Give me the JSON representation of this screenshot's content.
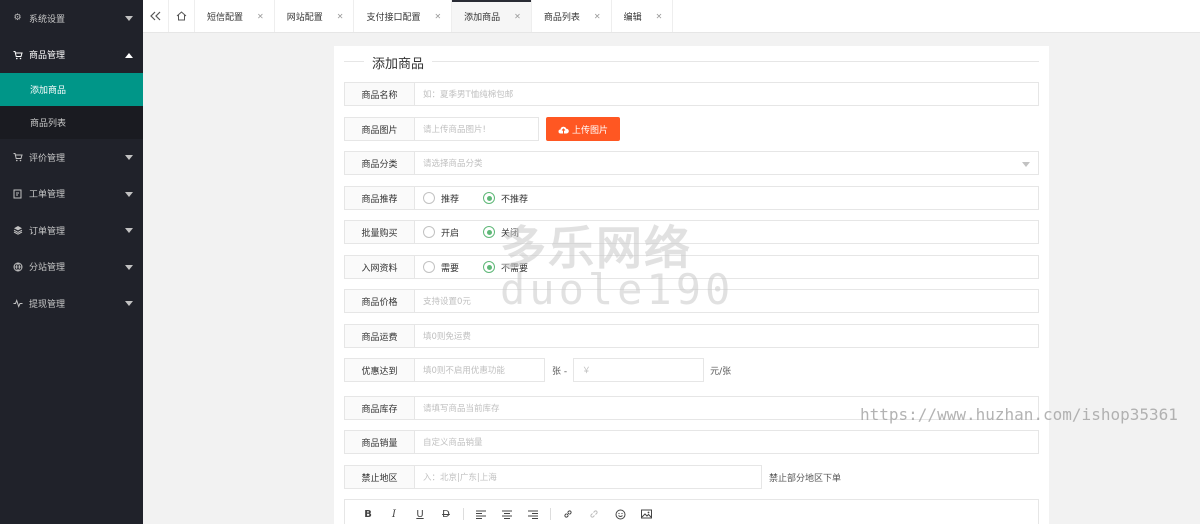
{
  "sidebar": {
    "items": [
      {
        "label": "系统设置",
        "icon": "gear-icon"
      },
      {
        "label": "商品管理",
        "icon": "cart-icon",
        "open": true
      },
      {
        "label": "评价管理",
        "icon": "cart-icon"
      },
      {
        "label": "工单管理",
        "icon": "ticket-icon"
      },
      {
        "label": "订单管理",
        "icon": "layers-icon"
      },
      {
        "label": "分站管理",
        "icon": "globe-icon"
      },
      {
        "label": "提现管理",
        "icon": "pulse-icon"
      }
    ],
    "sub_items": [
      {
        "label": "添加商品",
        "active": true
      },
      {
        "label": "商品列表"
      }
    ]
  },
  "tabs": [
    {
      "label": "短信配置"
    },
    {
      "label": "网站配置"
    },
    {
      "label": "支付接口配置"
    },
    {
      "label": "添加商品",
      "active": true
    },
    {
      "label": "商品列表"
    },
    {
      "label": "编辑"
    }
  ],
  "form": {
    "title": "添加商品",
    "name": {
      "label": "商品名称",
      "placeholder": "如：夏季男T恤纯棉包邮"
    },
    "image": {
      "label": "商品图片",
      "placeholder": "请上传商品图片!",
      "button": "上传图片"
    },
    "category": {
      "label": "商品分类",
      "placeholder": "请选择商品分类"
    },
    "recommend": {
      "label": "商品推荐",
      "options": [
        "推荐",
        "不推荐"
      ],
      "selected": 1
    },
    "bulk": {
      "label": "批量购买",
      "options": [
        "开启",
        "关闭"
      ],
      "selected": 1
    },
    "material": {
      "label": "入网资料",
      "options": [
        "需要",
        "不需要"
      ],
      "selected": 1
    },
    "price": {
      "label": "商品价格",
      "placeholder": "支持设置0元"
    },
    "shipping": {
      "label": "商品运费",
      "placeholder": "填0则免运费"
    },
    "discount": {
      "label": "优惠达到",
      "placeholder": "填0则不启用优惠功能",
      "unit1": "张 -",
      "placeholder2": "￥",
      "unit2": "元/张"
    },
    "stock": {
      "label": "商品库存",
      "placeholder": "请填写商品当前库存"
    },
    "sales": {
      "label": "商品销量",
      "placeholder": "自定义商品销量"
    },
    "region": {
      "label": "禁止地区",
      "placeholder": "入：北京|广东|上海",
      "note": "禁止部分地区下单"
    }
  },
  "editor": {
    "tools": [
      "B",
      "I",
      "U",
      "D"
    ]
  },
  "watermark": {
    "line1": "多乐网络",
    "line2": "duole190",
    "url": "https://www.huzhan.com/ishop35361"
  }
}
